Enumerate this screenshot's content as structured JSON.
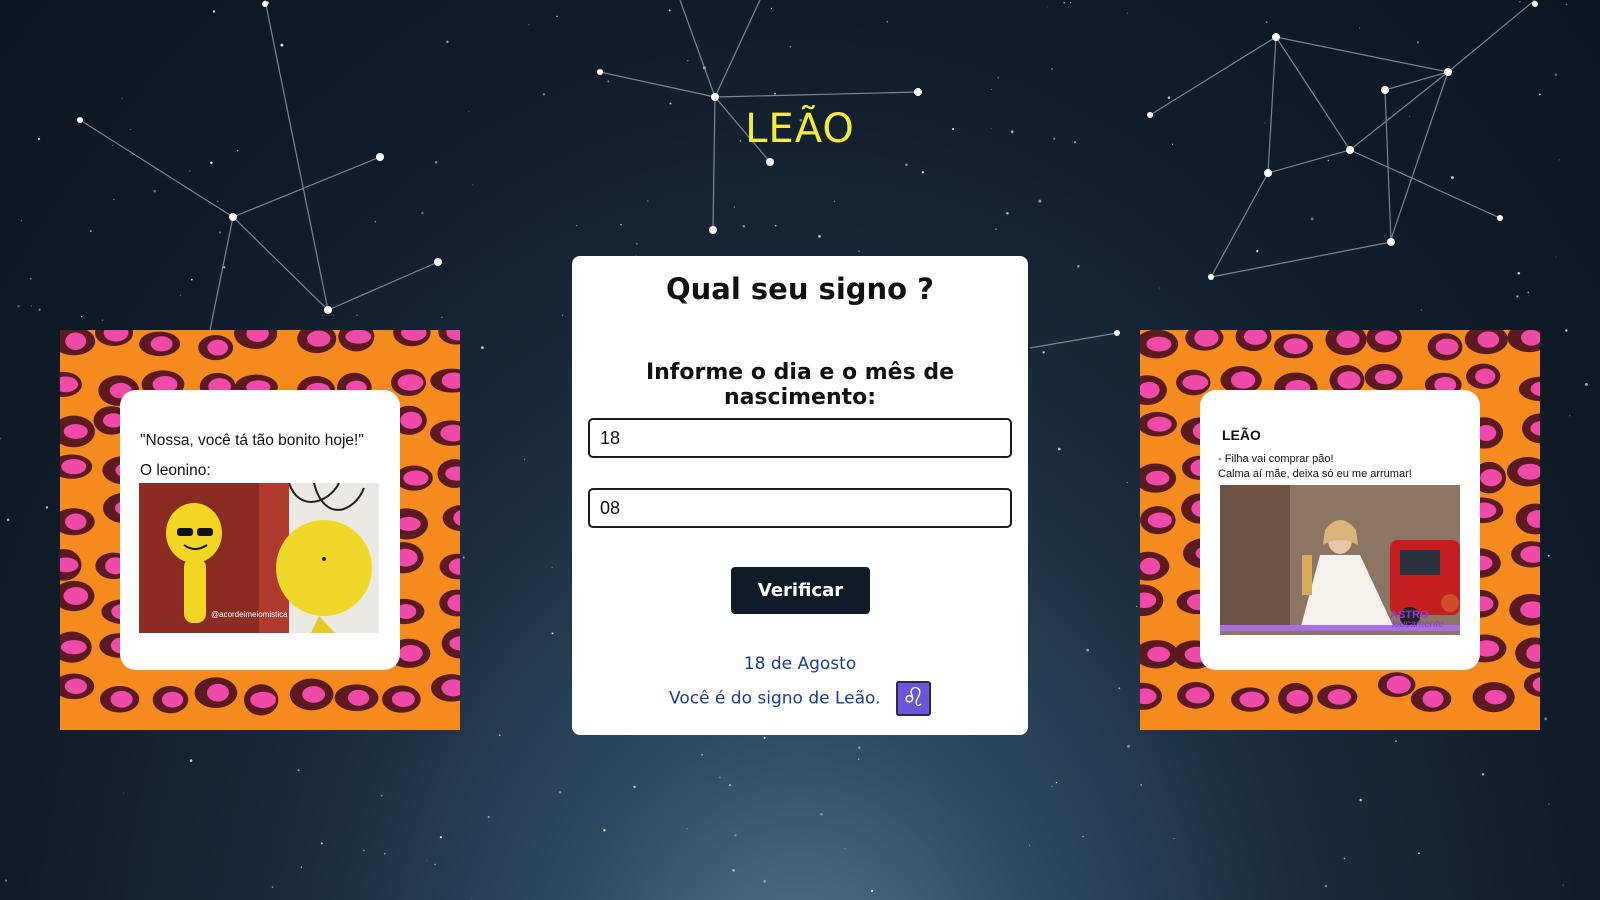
{
  "page": {
    "title": "LEÃO"
  },
  "form": {
    "heading": "Qual seu signo ?",
    "instruction": "Informe o dia e o mês de nascimento:",
    "day_value": "18",
    "month_value": "08",
    "submit_label": "Verificar"
  },
  "result": {
    "date_text": "18 de Agosto",
    "sign_text": "Você é do signo de Leão.",
    "sign_symbol": "♌"
  },
  "memes": {
    "left": {
      "quote": "\"Nossa, você tá tão bonito hoje!\"",
      "caption": "O leonino:",
      "watermark": "@acordeimeiomistica"
    },
    "right": {
      "title": "LEÃO",
      "line1": "- Filha vai comprar pão!",
      "line2": "Calma aí mãe, deixa só eu me arrumar!",
      "brand_line1": "ASTRO",
      "brand_line2": "loucamente"
    }
  },
  "colors": {
    "title_yellow": "#f2ea3c",
    "result_blue": "#1c3b8c",
    "button_bg": "#0f1c27",
    "leo_badge": "#6a56d6",
    "leopard_orange": "#f58a1f",
    "leopard_pink": "#ef4aa8",
    "leopard_brown": "#5a1a1e"
  }
}
